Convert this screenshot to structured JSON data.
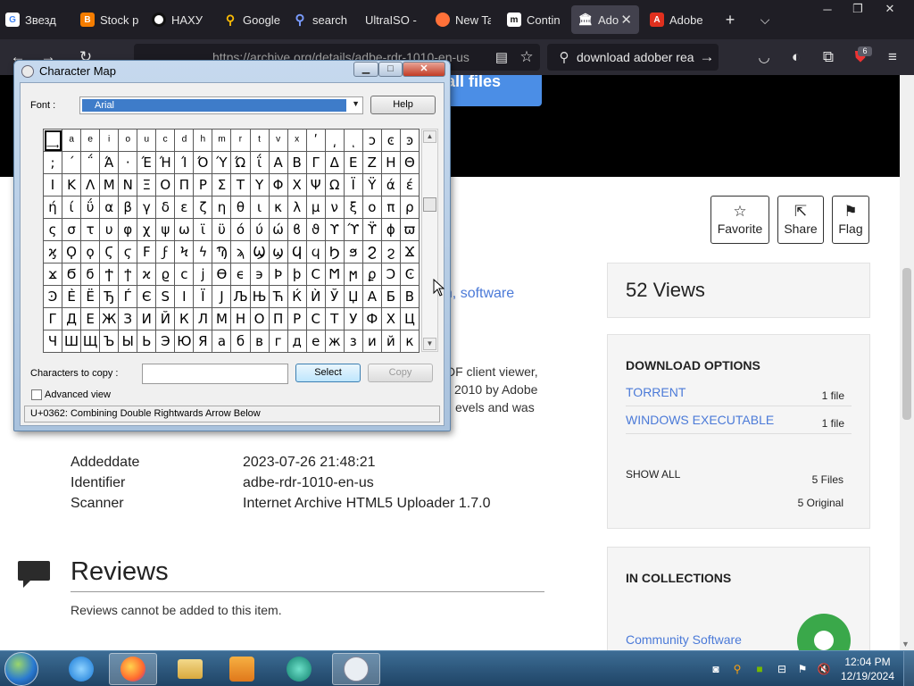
{
  "browser": {
    "tabs": [
      {
        "title": "Звезд",
        "icon": "google-icon",
        "color": "#4285f4"
      },
      {
        "title": "Stock p",
        "icon": "blogger-icon",
        "color": "#f57d00"
      },
      {
        "title": "НАХУ",
        "icon": "circle-logo-icon",
        "color": "#ffffff"
      },
      {
        "title": "Google",
        "icon": "maps-pin-icon",
        "color": "#34a853"
      },
      {
        "title": "search",
        "icon": "search-icon",
        "color": "#7a9cff"
      },
      {
        "title": "UltraISO -",
        "icon": "blank-icon",
        "color": "#888888"
      },
      {
        "title": "New Ta",
        "icon": "firefox-icon",
        "color": "#ff7139"
      },
      {
        "title": "Contin",
        "icon": "m-logo-icon",
        "color": "#ffffff"
      },
      {
        "title": "Ado",
        "icon": "archive-icon",
        "color": "#ffffff",
        "active": true
      },
      {
        "title": "Adobe",
        "icon": "adobe-icon",
        "color": "#e0301e"
      }
    ],
    "url": "https://archive.org/details/adbe-rdr-1010-en-us",
    "search_query": "download adober rea",
    "extension_badge": "6"
  },
  "page": {
    "all_files_label": "all files",
    "actions": [
      {
        "label": "Favorite",
        "icon": "star-icon"
      },
      {
        "label": "Share",
        "icon": "share-icon"
      },
      {
        "label": "Flag",
        "icon": "flag-icon"
      }
    ],
    "views_text": "52 Views",
    "download_options": {
      "title": "DOWNLOAD OPTIONS",
      "items": [
        {
          "label": "TORRENT",
          "count": "1 file"
        },
        {
          "label": "WINDOWS EXECUTABLE",
          "count": "1 file"
        }
      ],
      "show_all": "SHOW ALL",
      "files_count": "5 Files",
      "original_count": "5 Original"
    },
    "collections": {
      "title": "IN COLLECTIONS",
      "item": "Community Software"
    },
    "topics_partial": "on, software",
    "description_lines": [
      "DF client viewer,",
      "2010 by Adobe",
      "evels and was"
    ],
    "metadata": [
      {
        "key": "Addeddate",
        "value": "2023-07-26 21:48:21"
      },
      {
        "key": "Identifier",
        "value": "adbe-rdr-1010-en-us"
      },
      {
        "key": "Scanner",
        "value": "Internet Archive HTML5 Uploader 1.7.0"
      }
    ],
    "reviews": {
      "title": "Reviews",
      "text": "Reviews cannot be added to this item."
    }
  },
  "charmap": {
    "title": "Character Map",
    "font_label": "Font :",
    "font_value": "Arial",
    "help_label": "Help",
    "chars_label": "Characters to copy :",
    "chars_value": "",
    "select_label": "Select",
    "copy_label": "Copy",
    "advanced_label": "Advanced view",
    "advanced_checked": false,
    "status": "U+0362: Combining Double Rightwards Arrow Below",
    "grid": [
      [
        "͢",
        "ͣ",
        "ͤ",
        "ͥ",
        "ͦ",
        "ͧ",
        "ͨ",
        "ͩ",
        "ͪ",
        "ͫ",
        "ͬ",
        "ͭ",
        "ͮ",
        "ͯ",
        "ʹ",
        "͵",
        "ͺ",
        "ͻ",
        "ͼ",
        "ͽ"
      ],
      [
        ";",
        "΄",
        "΅",
        "Ά",
        "·",
        "Έ",
        "Ή",
        "Ί",
        "Ό",
        "Ύ",
        "Ώ",
        "ΐ",
        "Α",
        "Β",
        "Γ",
        "Δ",
        "Ε",
        "Ζ",
        "Η",
        "Θ"
      ],
      [
        "Ι",
        "Κ",
        "Λ",
        "Μ",
        "Ν",
        "Ξ",
        "Ο",
        "Π",
        "Ρ",
        "Σ",
        "Τ",
        "Υ",
        "Φ",
        "Χ",
        "Ψ",
        "Ω",
        "Ϊ",
        "Ϋ",
        "ά",
        "έ"
      ],
      [
        "ή",
        "ί",
        "ΰ",
        "α",
        "β",
        "γ",
        "δ",
        "ε",
        "ζ",
        "η",
        "θ",
        "ι",
        "κ",
        "λ",
        "μ",
        "ν",
        "ξ",
        "ο",
        "π",
        "ρ"
      ],
      [
        "ς",
        "σ",
        "τ",
        "υ",
        "φ",
        "χ",
        "ψ",
        "ω",
        "ϊ",
        "ϋ",
        "ό",
        "ύ",
        "ώ",
        "ϐ",
        "ϑ",
        "ϒ",
        "ϓ",
        "ϔ",
        "ϕ",
        "ϖ"
      ],
      [
        "ϗ",
        "Ϙ",
        "ϙ",
        "Ϛ",
        "ϛ",
        "Ϝ",
        "ϝ",
        "Ϟ",
        "ϟ",
        "Ϡ",
        "ϡ",
        "Ϣ",
        "ϣ",
        "Ϥ",
        "ϥ",
        "Ϧ",
        "ϧ",
        "Ϩ",
        "ϩ",
        "Ϫ"
      ],
      [
        "ϫ",
        "Ϭ",
        "ϭ",
        "Ϯ",
        "ϯ",
        "ϰ",
        "ϱ",
        "ϲ",
        "ϳ",
        "ϴ",
        "ϵ",
        "϶",
        "Ϸ",
        "ϸ",
        "Ϲ",
        "Ϻ",
        "ϻ",
        "ϼ",
        "Ͻ",
        "Ͼ"
      ],
      [
        "Ͽ",
        "Ѐ",
        "Ё",
        "Ђ",
        "Ѓ",
        "Є",
        "Ѕ",
        "І",
        "Ї",
        "Ј",
        "Љ",
        "Њ",
        "Ћ",
        "Ќ",
        "Ѝ",
        "Ў",
        "Џ",
        "А",
        "Б",
        "В"
      ],
      [
        "Г",
        "Д",
        "Е",
        "Ж",
        "З",
        "И",
        "Й",
        "К",
        "Л",
        "М",
        "Н",
        "О",
        "П",
        "Р",
        "С",
        "Т",
        "У",
        "Ф",
        "Х",
        "Ц"
      ],
      [
        "Ч",
        "Ш",
        "Щ",
        "Ъ",
        "Ы",
        "Ь",
        "Э",
        "Ю",
        "Я",
        "а",
        "б",
        "в",
        "г",
        "д",
        "е",
        "ж",
        "з",
        "и",
        "й",
        "к"
      ]
    ]
  },
  "taskbar": {
    "apps": [
      "ie-icon",
      "firefox-icon",
      "explorer-icon",
      "media-player-icon",
      "photo-viewer-icon",
      "charmap-icon"
    ],
    "time": "12:04 PM",
    "date": "12/19/2024"
  }
}
